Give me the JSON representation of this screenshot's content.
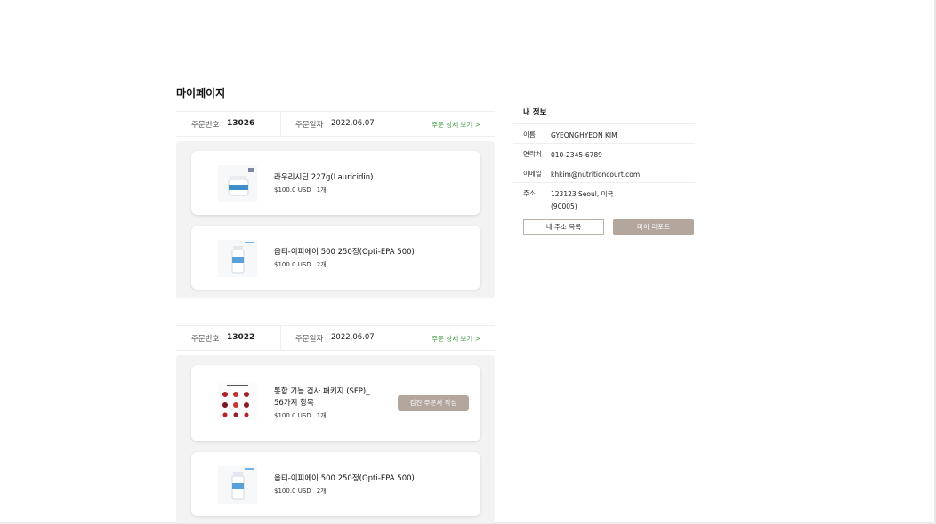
{
  "page_title": "마이페이지",
  "orders": [
    {
      "order_no_label": "주문번호",
      "order_no": "13026",
      "date_label": "주문일자",
      "date": "2022.06.07",
      "detail_link": "주문 상세 보기 >",
      "items": [
        {
          "name": "라우리시딘 227g(Lauricidin)",
          "price": "$100.0 USD",
          "qty": "1개",
          "thumb_icon": "jar-icon"
        },
        {
          "name": "옵티-이피에이 500 250정(Opti-EPA 500)",
          "price": "$100.0 USD",
          "qty": "2개",
          "thumb_icon": "bottle-icon"
        }
      ]
    },
    {
      "order_no_label": "주문번호",
      "order_no": "13022",
      "date_label": "주문일자",
      "date": "2022.06.07",
      "detail_link": "주문 상세 보기 >",
      "items": [
        {
          "name": "통합 기능 검사 패키지 (SFP)_ 56가지 항목",
          "price": "$100.0 USD",
          "qty": "1개",
          "thumb_icon": "test-kit-icon",
          "action": "검진 주문서 작성"
        },
        {
          "name": "옵티-이피에이 500 250정(Opti-EPA 500)",
          "price": "$100.0 USD",
          "qty": "2개",
          "thumb_icon": "bottle-icon"
        }
      ]
    }
  ],
  "my_info": {
    "title": "내 정보",
    "rows": [
      {
        "label": "이름",
        "value": "GYEONGHYEON KIM"
      },
      {
        "label": "연락처",
        "value": "010-2345-6789"
      },
      {
        "label": "이메일",
        "value": "khkim@nutritioncourt.com"
      },
      {
        "label": "주소",
        "value": "123123 Seoul, 미국",
        "value2": "(90005)"
      }
    ],
    "address_list_button": "내 주소 목록",
    "my_report_button": "마이 리포트"
  },
  "colors": {
    "accent": "#b2a69d",
    "link": "#3a9a3a",
    "panel_bg": "#f3f3f3"
  }
}
